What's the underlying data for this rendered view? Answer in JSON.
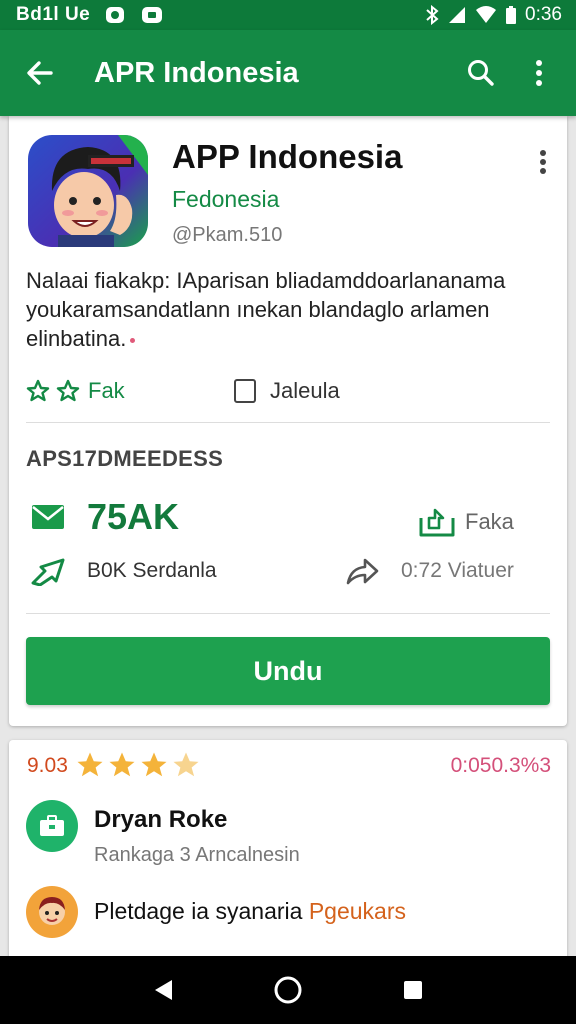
{
  "status_bar": {
    "carrier": "Bd1l Ue",
    "time": "0:36"
  },
  "app_bar": {
    "title": "APR Indonesia"
  },
  "app": {
    "name": "APP Indonesia",
    "developer": "Fedonesia",
    "meta": "@Pkam.510",
    "description": "Nalaai fiakakp: IAparisan bliadamddoarlananama youkaramsandatlann ınekan blandaglo arlamen elinbatina.",
    "rating_label": "Fak",
    "checkbox_label": "Jaleula"
  },
  "stats": {
    "section_title": "APS17DMEEDESS",
    "count": "75AK",
    "share_label": "Faka",
    "sub_label": "B0K Serdanla",
    "version_label": "0:72 Viatuer"
  },
  "install_button": {
    "label": "Undu"
  },
  "ratings": {
    "score": "9.03",
    "stars": 3.5,
    "percent": "0:050.3%3",
    "reviews": [
      {
        "name": "Dryan Roke",
        "subtitle": "Rankaga 3 Arncalnesin"
      },
      {
        "text": "Pletdage ia syanaria ",
        "accent": "Pgeukars"
      }
    ]
  },
  "colors": {
    "primary": "#148a45",
    "status_bar": "#0d7a3a",
    "install": "#1ea14f",
    "star": "#f4b33a",
    "accent_orange": "#d14a1e",
    "accent_pink": "#d4507a"
  },
  "icons": {
    "back": "arrow-left-icon",
    "search": "search-icon",
    "more": "more-vert-icon",
    "mail": "mail-icon",
    "share": "share-icon",
    "install_arrow": "arrow-icon",
    "forward": "forward-icon"
  }
}
